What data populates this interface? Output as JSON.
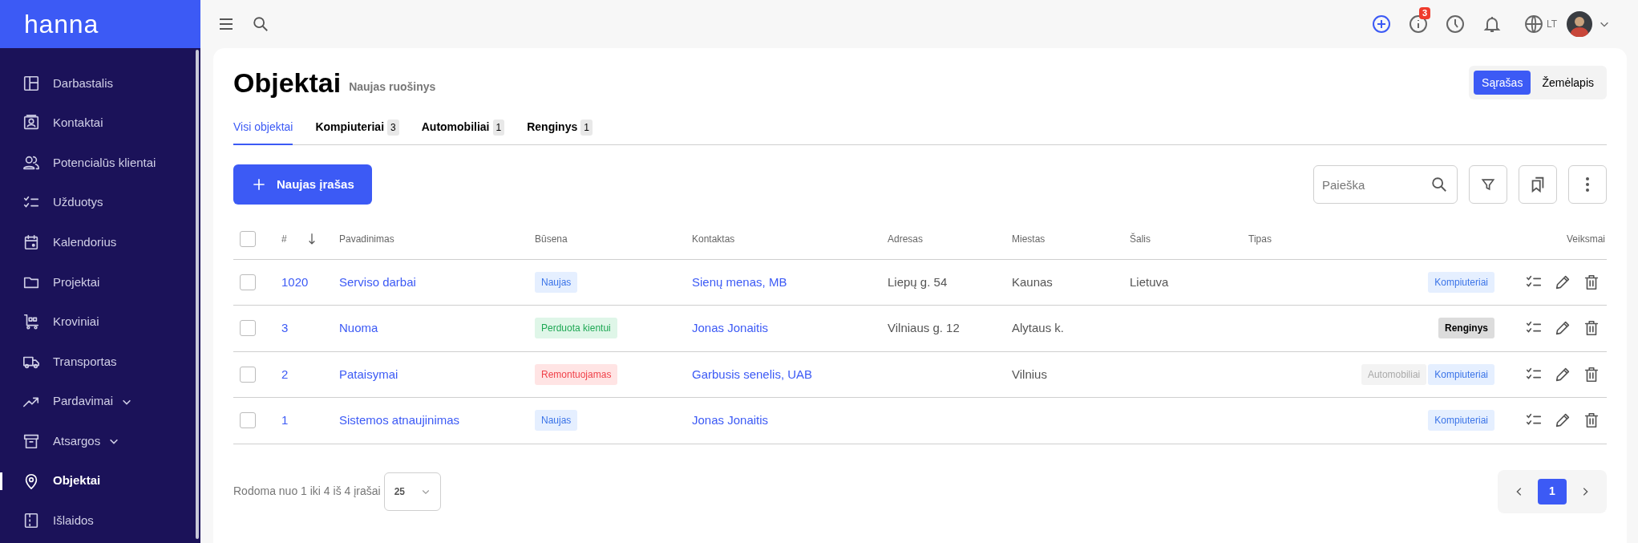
{
  "sidebar": {
    "logo": "hanna",
    "items": [
      {
        "label": "Darbastalis",
        "selected": false,
        "expandable": false
      },
      {
        "label": "Kontaktai",
        "selected": false,
        "expandable": false
      },
      {
        "label": "Potencialūs klientai",
        "selected": false,
        "expandable": false
      },
      {
        "label": "Užduotys",
        "selected": false,
        "expandable": false
      },
      {
        "label": "Kalendorius",
        "selected": false,
        "expandable": false
      },
      {
        "label": "Projektai",
        "selected": false,
        "expandable": false
      },
      {
        "label": "Kroviniai",
        "selected": false,
        "expandable": false
      },
      {
        "label": "Transportas",
        "selected": false,
        "expandable": false
      },
      {
        "label": "Pardavimai",
        "selected": false,
        "expandable": true
      },
      {
        "label": "Atsargos",
        "selected": false,
        "expandable": true
      },
      {
        "label": "Objektai",
        "selected": true,
        "expandable": false
      },
      {
        "label": "Išlaidos",
        "selected": false,
        "expandable": false
      }
    ]
  },
  "topbar": {
    "notification_count": "3",
    "language": "LT"
  },
  "page": {
    "title": "Objektai",
    "subtitle": "Naujas ruošinys"
  },
  "view_toggle": [
    {
      "label": "Sąrašas",
      "selected": true
    },
    {
      "label": "Žemėlapis",
      "selected": false
    }
  ],
  "tabs": [
    {
      "label": "Visi objektai",
      "selected": true
    },
    {
      "label": "Kompiuteriai",
      "count": "3",
      "selected": false
    },
    {
      "label": "Automobiliai",
      "count": "1",
      "selected": false
    },
    {
      "label": "Renginys",
      "count": "1",
      "selected": false
    }
  ],
  "new_button": "Naujas įrašas",
  "search": {
    "placeholder": "Paieška"
  },
  "table": {
    "header_checked": false,
    "columns": [
      "#",
      "Pavadinimas",
      "Būsena",
      "Kontaktas",
      "Adresas",
      "Miestas",
      "Šalis",
      "Tipas",
      "Veiksmai"
    ],
    "rows": [
      {
        "checked": false,
        "id": "1020",
        "name": "Serviso darbai",
        "status": {
          "label": "Naujas",
          "kind": "info"
        },
        "contact": "Sienų menas, MB",
        "address": "Liepų g. 54",
        "city": "Kaunas",
        "country": "Lietuva",
        "types": [
          {
            "label": "Kompiuteriai",
            "kind": "primary"
          }
        ]
      },
      {
        "checked": false,
        "id": "3",
        "name": "Nuoma",
        "status": {
          "label": "Perduota kientui",
          "kind": "success"
        },
        "contact": "Jonas Jonaitis",
        "address": "Vilniaus g. 12",
        "city": "Alytaus k.",
        "types": [
          {
            "label": "Renginys",
            "kind": "dark"
          }
        ]
      },
      {
        "checked": false,
        "id": "2",
        "name": "Pataisymai",
        "status": {
          "label": "Remontuojamas",
          "kind": "danger"
        },
        "contact": "Garbusis senelis, UAB",
        "city": "Vilnius",
        "types": [
          {
            "label": "Automobiliai",
            "kind": "muted"
          },
          {
            "label": "Kompiuteriai",
            "kind": "primary"
          }
        ]
      },
      {
        "checked": false,
        "id": "1",
        "name": "Sistemos atnaujinimas",
        "status": {
          "label": "Naujas",
          "kind": "info"
        },
        "contact": "Jonas Jonaitis",
        "types": [
          {
            "label": "Kompiuteriai",
            "kind": "primary"
          }
        ]
      }
    ]
  },
  "footer": {
    "summary": "Rodoma nuo 1 iki 4 iš 4 įrašai",
    "page_size": "25",
    "pages": [
      {
        "label": "1",
        "selected": true
      }
    ]
  }
}
